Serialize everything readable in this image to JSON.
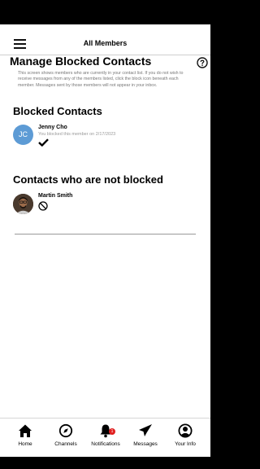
{
  "header": {
    "title": "All Members"
  },
  "page": {
    "title": "Manage Blocked Contacts",
    "description": "This screen shows members who are currently in your contact list. If you do not wish to receive messages from any of the members listed, click the block icon beneath each member. Messages sent by those members will not appear in your inbox."
  },
  "blocked": {
    "title": "Blocked Contacts",
    "members": [
      {
        "initials": "JC",
        "name": "Jenny Cho",
        "status": "You blocked this member on 2/17/2023",
        "avatar_color": "#5d9bd5"
      }
    ]
  },
  "unblocked": {
    "title": "Contacts who are not blocked",
    "members": [
      {
        "name": "Martin Smith"
      }
    ]
  },
  "nav": {
    "items": [
      {
        "label": "Home",
        "icon": "home-icon"
      },
      {
        "label": "Channels",
        "icon": "compass-icon"
      },
      {
        "label": "Notifications",
        "icon": "bell-icon",
        "badge": "1"
      },
      {
        "label": "Messages",
        "icon": "paper-plane-icon"
      },
      {
        "label": "Your Info",
        "icon": "user-circle-icon"
      }
    ]
  },
  "colors": {
    "badge": "#e02020",
    "avatar_jc": "#5d9bd5"
  }
}
